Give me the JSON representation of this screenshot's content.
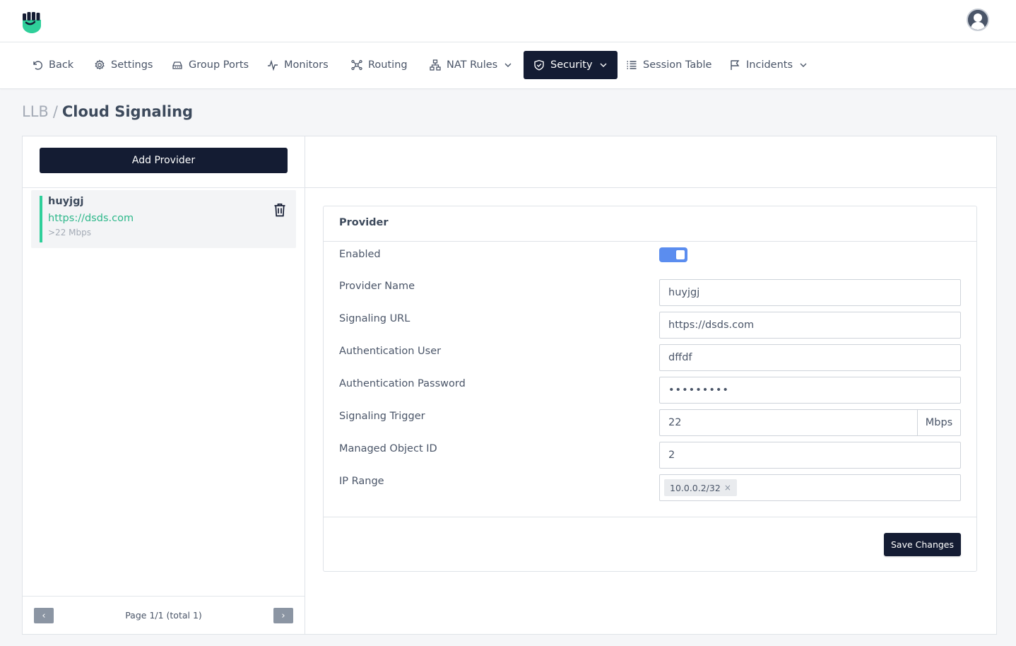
{
  "app": {
    "logo_icon": "fist-shield-logo",
    "avatar_icon": "user-avatar-icon"
  },
  "nav": {
    "items": [
      {
        "label": "Back",
        "icon": "undo-icon"
      },
      {
        "label": "Settings",
        "icon": "gear-icon"
      },
      {
        "label": "Group Ports",
        "icon": "router-icon"
      },
      {
        "label": "Monitors",
        "icon": "pulse-icon"
      },
      {
        "label": "Routing",
        "icon": "network-icon"
      },
      {
        "label": "NAT Rules",
        "icon": "sitemap-icon",
        "dropdown": true
      },
      {
        "label": "Security",
        "icon": "shield-check-icon",
        "dropdown": true,
        "active": true
      },
      {
        "label": "Session Table",
        "icon": "list-icon"
      },
      {
        "label": "Incidents",
        "icon": "flag-icon",
        "dropdown": true
      }
    ],
    "active_color": "#141c33"
  },
  "breadcrumb": {
    "root": "LLB",
    "separator": "/",
    "current": "Cloud Signaling"
  },
  "sidebar": {
    "add_button": "Add Provider",
    "providers": [
      {
        "name": "huyjgj",
        "url": "https://dsds.com",
        "rate": ">22 Mbps",
        "accent": "#2fcf9a"
      }
    ],
    "pager": {
      "prev": "‹",
      "next": "›",
      "text": "Page 1/1 (total 1)"
    }
  },
  "form": {
    "title": "Provider",
    "enabled": {
      "label": "Enabled",
      "value": true,
      "color": "#5b8def"
    },
    "provider_name": {
      "label": "Provider Name",
      "value": "huyjgj"
    },
    "signaling_url": {
      "label": "Signaling URL",
      "value": "https://dsds.com"
    },
    "auth_user": {
      "label": "Authentication User",
      "value": "dffdf"
    },
    "auth_password": {
      "label": "Authentication Password",
      "value": "•••••••••"
    },
    "signaling_trigger": {
      "label": "Signaling Trigger",
      "value": "22",
      "unit": "Mbps"
    },
    "managed_object_id": {
      "label": "Managed Object ID",
      "value": "2"
    },
    "ip_range": {
      "label": "IP Range",
      "tags": [
        "10.0.0.2/32"
      ],
      "remove": "×"
    },
    "save_button": "Save Changes"
  }
}
